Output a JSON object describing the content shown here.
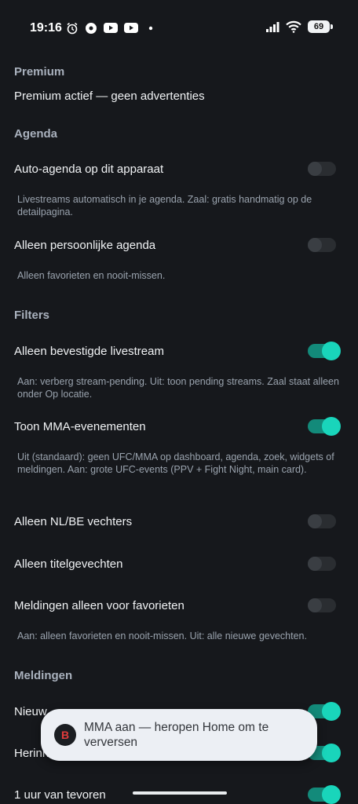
{
  "status": {
    "time": "19:16",
    "battery": "69",
    "left_icons": [
      "alarm-icon",
      "location-icon",
      "youtube-icon",
      "youtube-icon",
      "dot-icon"
    ],
    "right_icons": [
      "signal-icon",
      "wifi-icon",
      "battery-icon"
    ]
  },
  "premium": {
    "header": "Premium",
    "text": "Premium actief — geen advertenties"
  },
  "agenda": {
    "header": "Agenda",
    "auto": {
      "title": "Auto-agenda op dit apparaat",
      "desc": "Livestreams automatisch in je agenda. Zaal: gratis handmatig op de detailpagina.",
      "on": false
    },
    "personal": {
      "title": "Alleen persoonlijke agenda",
      "desc": "Alleen favorieten en nooit-missen.",
      "on": false
    }
  },
  "filters": {
    "header": "Filters",
    "confirmed": {
      "title": "Alleen bevestigde livestream",
      "desc": "Aan: verberg stream-pending. Uit: toon pending streams. Zaal staat alleen onder Op locatie.",
      "on": true
    },
    "mma": {
      "title": "Toon MMA-evenementen",
      "desc": "Uit (standaard): geen UFC/MMA op dashboard, agenda, zoek, widgets of meldingen. Aan: grote UFC-events (PPV + Fight Night, main card).",
      "on": true
    },
    "nlbe": {
      "title": "Alleen NL/BE vechters",
      "on": false
    },
    "titles": {
      "title": "Alleen titelgevechten",
      "on": false
    },
    "favorites": {
      "title": "Meldingen alleen voor favorieten",
      "desc": "Aan: alleen favorieten en nooit-missen. Uit: alle nieuwe gevechten.",
      "on": false
    }
  },
  "notifications": {
    "header": "Meldingen",
    "row1": {
      "title": "Nieuw",
      "on": true
    },
    "row2": {
      "title": "Herinn",
      "on": true
    },
    "row3": {
      "title": "1 uur van tevoren",
      "on": true
    }
  },
  "toast": {
    "text": "MMA aan — heropen Home om te verversen",
    "icon_letter": "B"
  },
  "colors": {
    "background": "#16181c",
    "accent": "#19d5bb",
    "accent_track": "#138a7a",
    "toast_bg": "#eceff4"
  }
}
